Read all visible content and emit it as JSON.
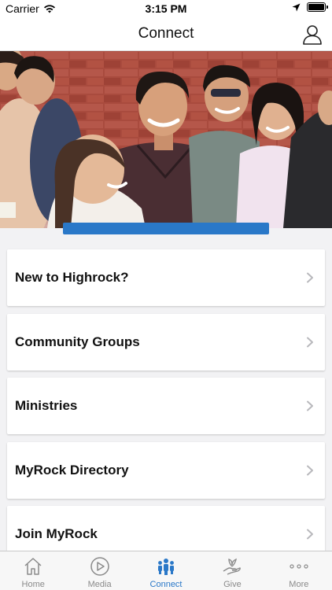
{
  "status_bar": {
    "carrier": "Carrier",
    "time": "3:15 PM",
    "battery_level": 1.0
  },
  "header": {
    "title": "Connect",
    "profile_icon": "person-icon"
  },
  "hero": {
    "accent_color": "#2a78c8"
  },
  "menu": {
    "items": [
      {
        "label": "New to Highrock?"
      },
      {
        "label": "Community Groups"
      },
      {
        "label": "Ministries"
      },
      {
        "label": "MyRock Directory"
      },
      {
        "label": "Join MyRock"
      }
    ]
  },
  "tab_bar": {
    "active_color": "#2a78c8",
    "inactive_color": "#8a8a8a",
    "tabs": [
      {
        "label": "Home",
        "icon": "home-icon",
        "active": false
      },
      {
        "label": "Media",
        "icon": "play-icon",
        "active": false
      },
      {
        "label": "Connect",
        "icon": "people-icon",
        "active": true
      },
      {
        "label": "Give",
        "icon": "give-hand-icon",
        "active": false
      },
      {
        "label": "More",
        "icon": "more-dots-icon",
        "active": false
      }
    ]
  }
}
